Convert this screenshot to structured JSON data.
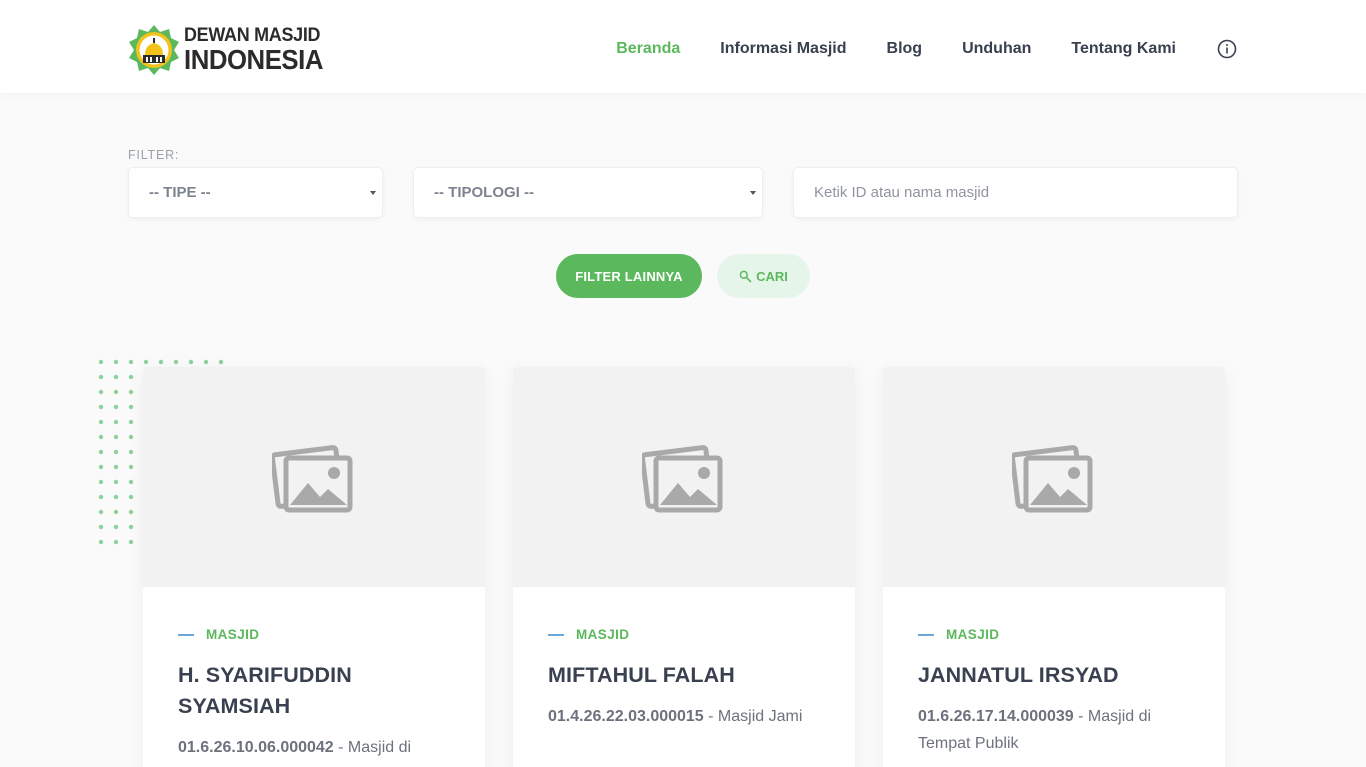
{
  "logo": {
    "line1": "DEWAN MASJID",
    "line2": "INDONESIA"
  },
  "nav": {
    "items": [
      {
        "label": "Beranda",
        "active": true
      },
      {
        "label": "Informasi Masjid",
        "active": false
      },
      {
        "label": "Blog",
        "active": false
      },
      {
        "label": "Unduhan",
        "active": false
      },
      {
        "label": "Tentang Kami",
        "active": false
      }
    ],
    "info_icon": "info-circle-icon"
  },
  "filter": {
    "label": "FILTER:",
    "tipe": "-- TIPE --",
    "tipologi": "-- TIPOLOGI --",
    "search_placeholder": "Ketik ID atau nama masjid",
    "btn_more": "FILTER LAINNYA",
    "btn_search": "CARI"
  },
  "cards": [
    {
      "type": "MASJID",
      "title": "H. SYARIFUDDIN SYAMSIAH",
      "code": "01.6.26.10.06.000042",
      "desc": " - Masjid di"
    },
    {
      "type": "MASJID",
      "title": "MIFTAHUL FALAH",
      "code": "01.4.26.22.03.000015",
      "desc": " - Masjid Jami"
    },
    {
      "type": "MASJID",
      "title": "JANNATUL IRSYAD",
      "code": "01.6.26.17.14.000039",
      "desc": " - Masjid di Tempat Publik"
    }
  ],
  "colors": {
    "accent": "#5cb85c",
    "text": "#39404f",
    "accent_light": "#e6f5ea"
  }
}
